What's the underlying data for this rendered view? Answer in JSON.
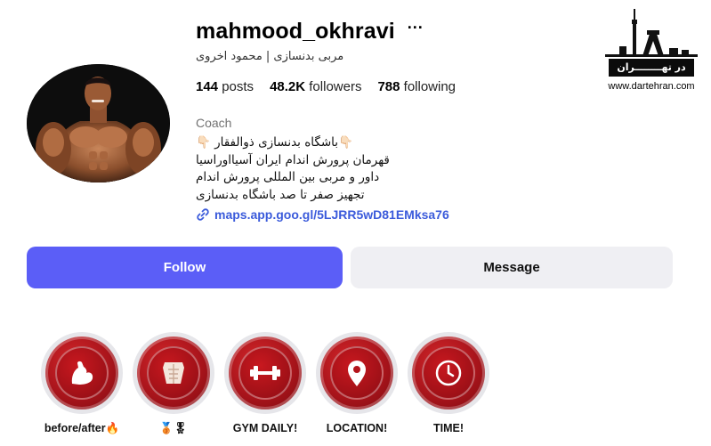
{
  "profile": {
    "username": "mahmood_okhravi",
    "more_label": "···",
    "full_name": "مربی بدنسازی | محمود اخروی",
    "stats": {
      "posts_count": "144",
      "posts_label": "posts",
      "followers_count": "48.2K",
      "followers_label": "followers",
      "following_count": "788",
      "following_label": "following"
    },
    "category": "Coach",
    "bio": [
      "👇🏻باشگاه بدنسازی ذوالفقار 👇🏻",
      "قهرمان پرورش اندام ایران آسیااوراسیا",
      "داور و مربی بین المللی پرورش اندام",
      "تجهیز صفر تا صد باشگاه بدنسازی"
    ],
    "link": "maps.app.goo.gl/5LJRR5wD81EMksa76"
  },
  "actions": {
    "follow_label": "Follow",
    "message_label": "Message"
  },
  "highlights": [
    {
      "label": "before/after🔥",
      "icon": "flexed-arm-icon"
    },
    {
      "label": "🥉🎖",
      "icon": "torso-muscles-icon"
    },
    {
      "label": "GYM DAILY!",
      "icon": "dumbbell-icon"
    },
    {
      "label": "LOCATION!",
      "icon": "location-pin-icon"
    },
    {
      "label": "TIME!",
      "icon": "clock-icon"
    }
  ],
  "watermark": {
    "banner": "در تهــــــــران",
    "url": "www.dartehran.com"
  },
  "colors": {
    "follow_button": "#5b5ef7",
    "message_button": "#efeff3",
    "link": "#3b5bdb",
    "highlight_red": "#b3141b"
  }
}
